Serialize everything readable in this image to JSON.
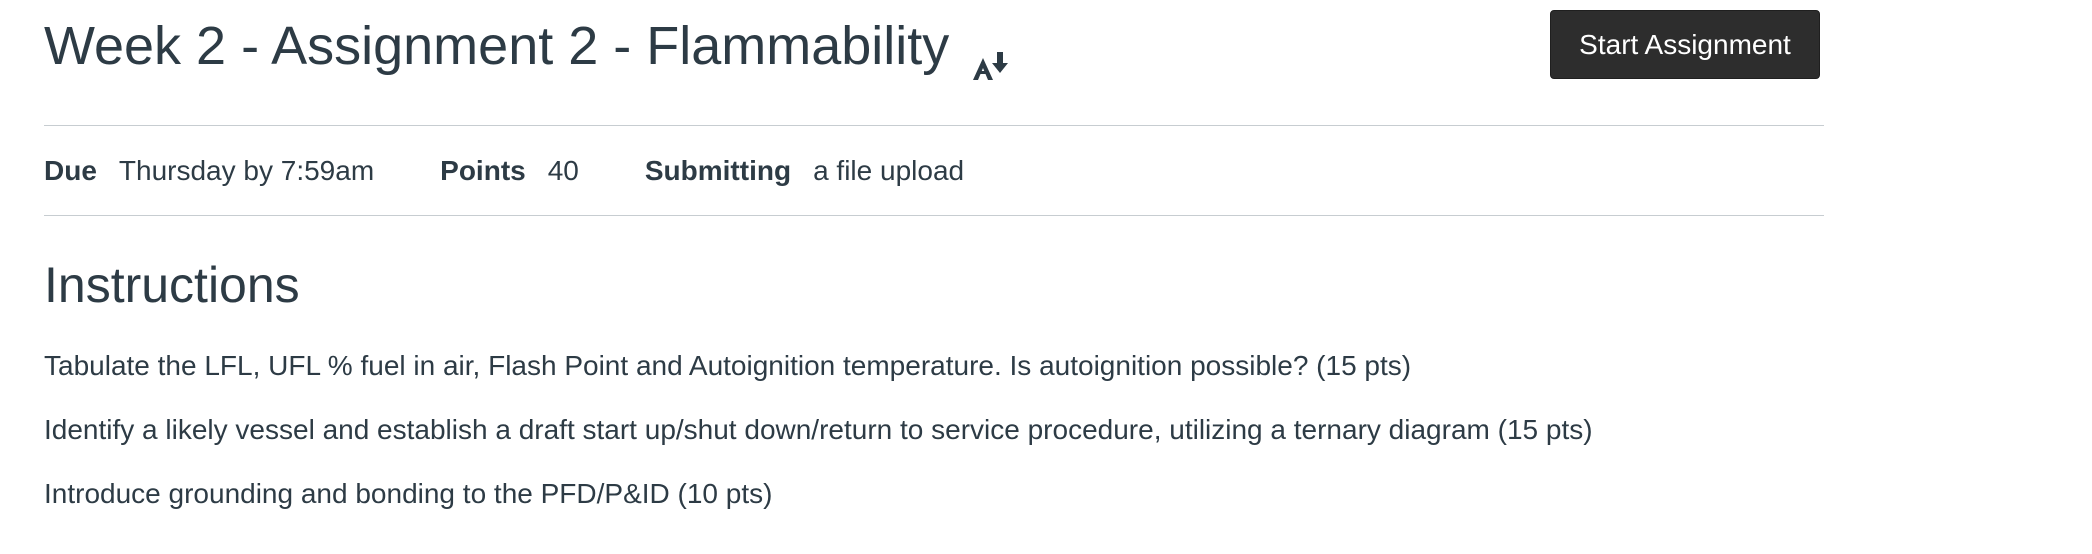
{
  "assignment": {
    "title": "Week 2 - Assignment 2 - Flammability",
    "title_icon": "ally-download-icon",
    "start_button_label": "Start Assignment"
  },
  "details": {
    "due_label": "Due",
    "due_value": "Thursday by 7:59am",
    "points_label": "Points",
    "points_value": "40",
    "submitting_label": "Submitting",
    "submitting_value": "a file upload"
  },
  "instructions": {
    "heading": "Instructions",
    "items": [
      "Tabulate the LFL, UFL % fuel in air, Flash Point and Autoignition temperature. Is autoignition possible? (15 pts)",
      "Identify a likely vessel and establish a draft start up/shut down/return to service procedure, utilizing a ternary diagram (15 pts)",
      "Introduce grounding and bonding to the PFD/P&ID (10 pts)"
    ]
  },
  "colors": {
    "text": "#2d3b45",
    "button_bg": "#2d2d2d",
    "button_text": "#ffffff",
    "divider": "#c7cdd1"
  }
}
